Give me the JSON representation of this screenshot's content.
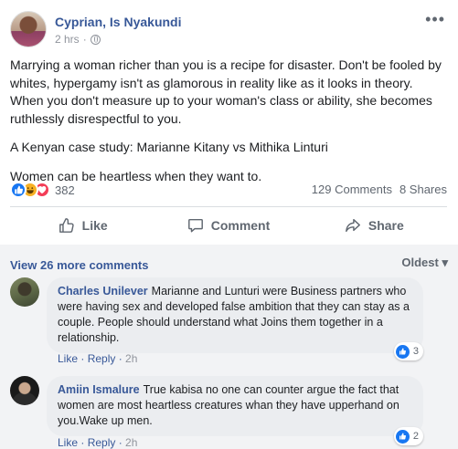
{
  "post": {
    "author": "Cyprian, Is Nyakundi",
    "time": "2 hrs",
    "dot": "·",
    "paragraphs": [
      "Marrying a woman richer than you is a recipe for disaster. Don't be fooled by whites, hypergamy isn't as glamorous in reality like as it looks in theory. When you don't measure up to your woman's class or ability, she becomes ruthlessly disrespectful to you.",
      "A Kenyan case study: Marianne Kitany vs Mithika Linturi",
      "Women can be heartless when they want to."
    ],
    "reaction_count": "382",
    "comments_count": "129 Comments",
    "shares_count": "8 Shares"
  },
  "actions": {
    "like": "Like",
    "comment": "Comment",
    "share": "Share"
  },
  "comments_section": {
    "view_more": "View 26 more comments",
    "sort": "Oldest",
    "sort_caret": "▾",
    "items": [
      {
        "name": "Charles Unilever",
        "text": "Marianne and Lunturi were Business partners who were having sex and developed false ambition that they can stay as a couple. People should understand what Joins them together in a relationship.",
        "like": "Like",
        "reply": "Reply",
        "time": "2h",
        "reactions": "3"
      },
      {
        "name": "Amiin Ismalure",
        "text": "True kabisa no one can counter argue the fact that women are most heartless creatures whan they have upperhand on you.Wake up men.",
        "like": "Like",
        "reply": "Reply",
        "time": "2h",
        "reactions": "2"
      }
    ]
  },
  "colors": {
    "link": "#385898",
    "muted": "#606770",
    "like_blue": "#1877f2",
    "love_red": "#f33e58",
    "haha_yellow": "#f7b125"
  },
  "icons": {
    "privacy": "globe-icon",
    "more": "more-options-icon",
    "like": "thumbs-up-icon",
    "comment": "speech-bubble-icon",
    "share": "share-arrow-icon"
  }
}
